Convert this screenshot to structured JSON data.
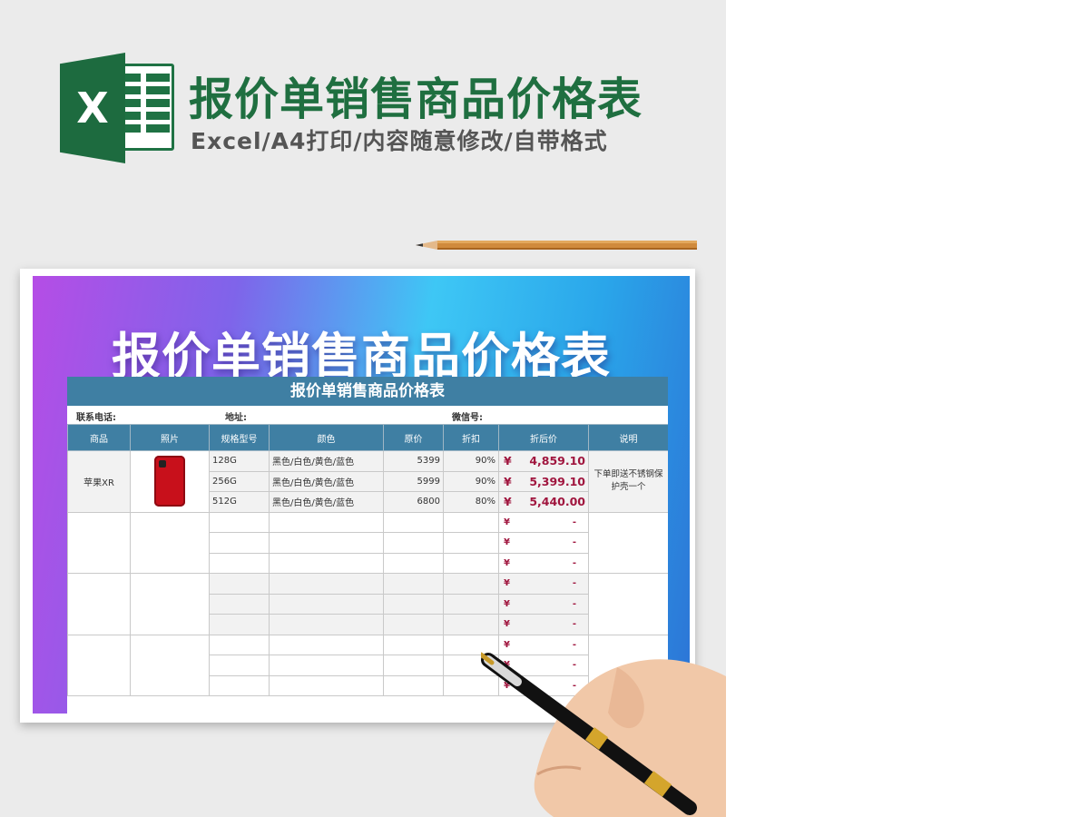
{
  "header": {
    "title": "报价单销售商品价格表",
    "subtitle": "Excel/A4打印/内容随意修改/自带格式",
    "logo_letter": "X",
    "logo_icon": "excel-logo-icon"
  },
  "banner": {
    "title": "报价单销售商品价格表"
  },
  "sheet": {
    "title": "报价单销售商品价格表",
    "info": {
      "phone_label": "联系电话:",
      "address_label": "地址:",
      "wechat_label": "微信号:"
    },
    "columns": [
      "商品",
      "照片",
      "规格型号",
      "颜色",
      "原价",
      "折扣",
      "折后价",
      "说明"
    ],
    "product": {
      "name": "苹果XR",
      "photo_icon": "red-iphone-image",
      "note": "下单即送不锈钢保护壳一个"
    },
    "rows": [
      {
        "spec": "128G",
        "color": "黑色/白色/黄色/蓝色",
        "price": "5399",
        "discount": "90%",
        "final": "4,859.10"
      },
      {
        "spec": "256G",
        "color": "黑色/白色/黄色/蓝色",
        "price": "5999",
        "discount": "90%",
        "final": "5,399.10"
      },
      {
        "spec": "512G",
        "color": "黑色/白色/黄色/蓝色",
        "price": "6800",
        "discount": "80%",
        "final": "5,440.00"
      }
    ],
    "currency": "¥",
    "empty_final": "-"
  },
  "colors": {
    "brand_green": "#1f6f40",
    "header_blue": "#3f7fa3",
    "price_red": "#a0153e"
  }
}
